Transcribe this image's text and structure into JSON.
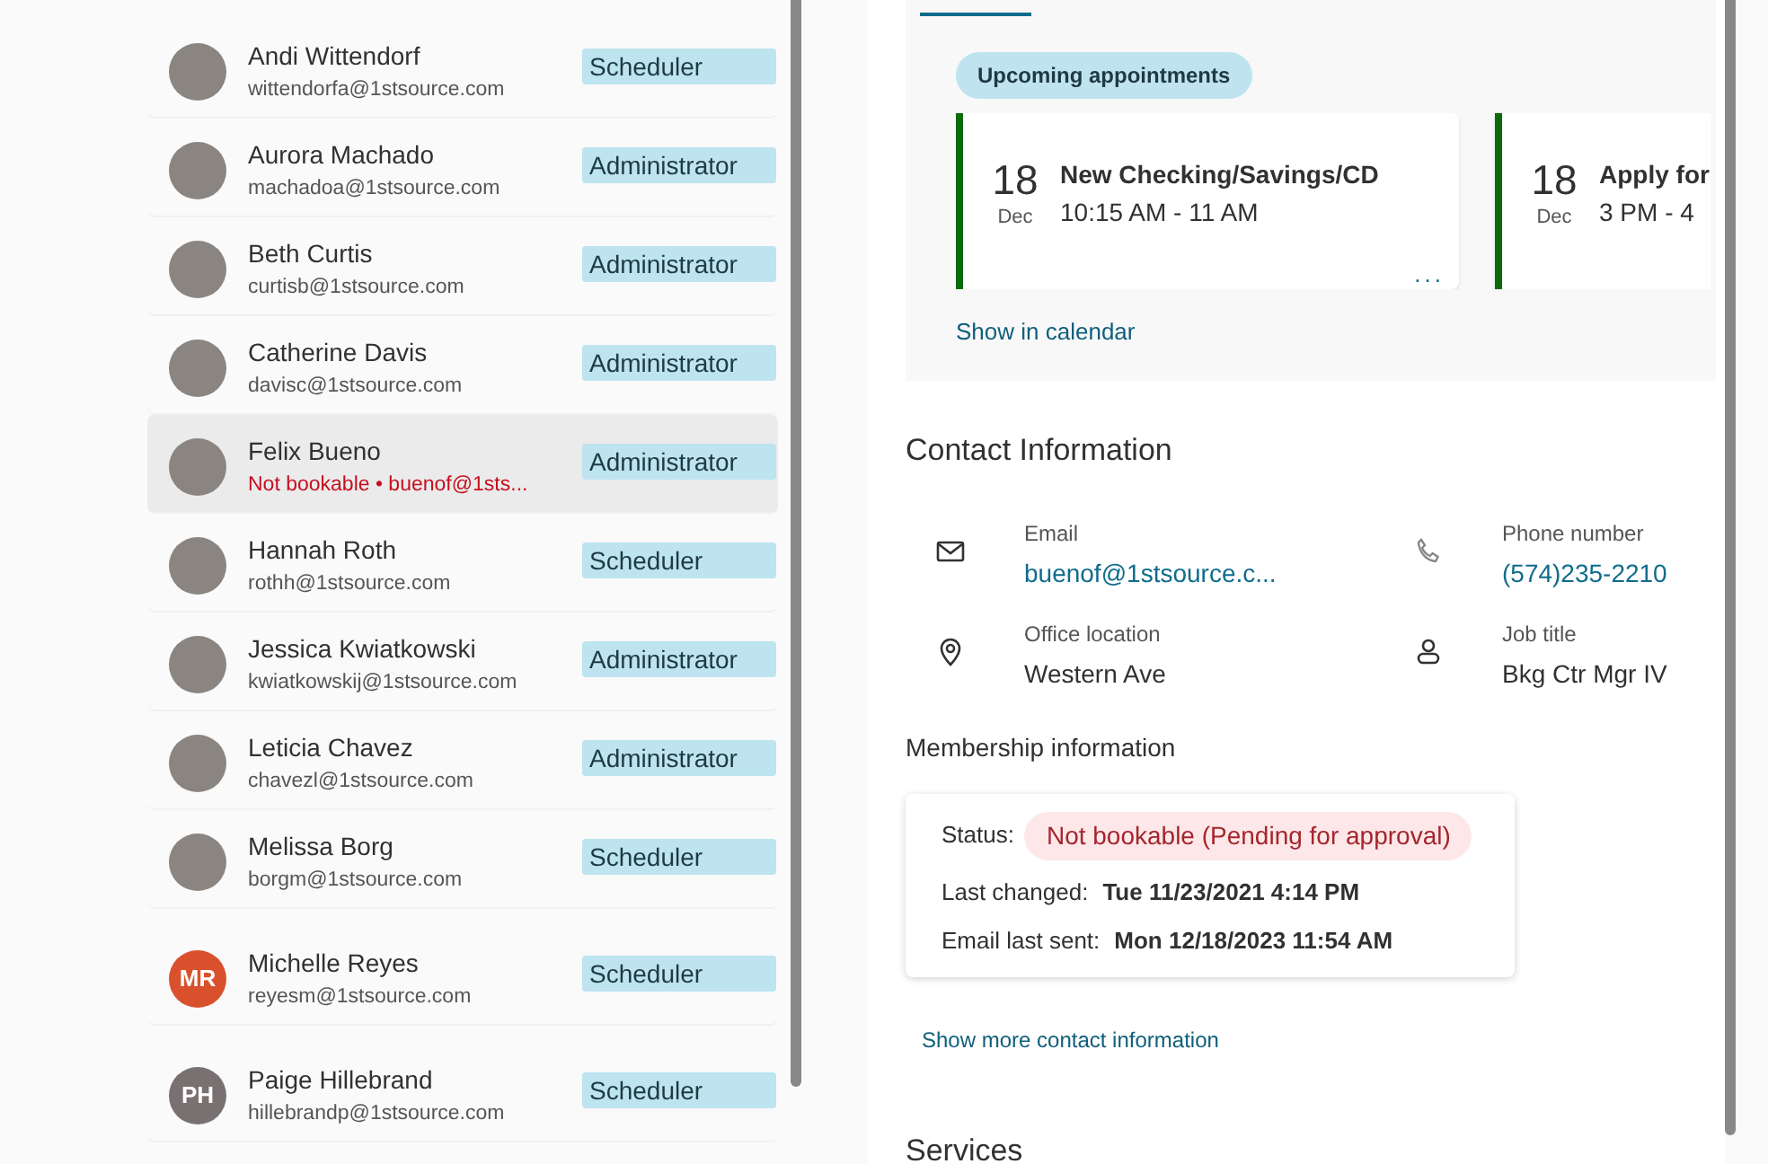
{
  "staff": [
    {
      "name": "Andi Wittendorf",
      "email": "wittendorfa@1stsource.com",
      "role": "Scheduler",
      "selected": false,
      "bookable": true,
      "avatar": {
        "kind": "photo"
      }
    },
    {
      "name": "Aurora Machado",
      "email": "machadoa@1stsource.com",
      "role": "Administrator",
      "selected": false,
      "bookable": true,
      "avatar": {
        "kind": "photo"
      }
    },
    {
      "name": "Beth Curtis",
      "email": "curtisb@1stsource.com",
      "role": "Administrator",
      "selected": false,
      "bookable": true,
      "avatar": {
        "kind": "photo"
      }
    },
    {
      "name": "Catherine Davis",
      "email": "davisc@1stsource.com",
      "role": "Administrator",
      "selected": false,
      "bookable": true,
      "avatar": {
        "kind": "photo"
      }
    },
    {
      "name": "Felix Bueno",
      "email": "Not bookable • buenof@1sts...",
      "role": "Administrator",
      "selected": true,
      "bookable": false,
      "avatar": {
        "kind": "photo"
      }
    },
    {
      "name": "Hannah Roth",
      "email": "rothh@1stsource.com",
      "role": "Scheduler",
      "selected": false,
      "bookable": true,
      "avatar": {
        "kind": "photo"
      }
    },
    {
      "name": "Jessica Kwiatkowski",
      "email": "kwiatkowskij@1stsource.com",
      "role": "Administrator",
      "selected": false,
      "bookable": true,
      "avatar": {
        "kind": "photo"
      }
    },
    {
      "name": "Leticia Chavez",
      "email": "chavezl@1stsource.com",
      "role": "Administrator",
      "selected": false,
      "bookable": true,
      "avatar": {
        "kind": "photo"
      }
    },
    {
      "name": "Melissa Borg",
      "email": "borgm@1stsource.com",
      "role": "Scheduler",
      "selected": false,
      "bookable": true,
      "avatar": {
        "kind": "photo"
      }
    },
    {
      "name": "Michelle Reyes",
      "email": "reyesm@1stsource.com",
      "role": "Scheduler",
      "selected": false,
      "bookable": true,
      "avatar": {
        "kind": "initials",
        "initials": "MR",
        "color": "#d9512c"
      }
    },
    {
      "name": "Paige Hillebrand",
      "email": "hillebrandp@1stsource.com",
      "role": "Scheduler",
      "selected": false,
      "bookable": true,
      "avatar": {
        "kind": "initials",
        "initials": "PH",
        "color": "#797171"
      }
    }
  ],
  "appointments": {
    "badge": "Upcoming appointments",
    "items": [
      {
        "day": "18",
        "month": "Dec",
        "title": "New Checking/Savings/CD",
        "time": "10:15 AM - 11 AM",
        "more": "..."
      },
      {
        "day": "18",
        "month": "Dec",
        "title": "Apply for",
        "time": "3 PM - 4"
      }
    ],
    "link": "Show in calendar"
  },
  "contact": {
    "title": "Contact Information",
    "fields": [
      {
        "kind": "email",
        "label": "Email",
        "value": "buenof@1stsource.c...",
        "link": true
      },
      {
        "kind": "phone",
        "label": "Phone number",
        "value": "(574)235-2210",
        "link": true
      },
      {
        "kind": "location",
        "label": "Office location",
        "value": "Western Ave",
        "link": false
      },
      {
        "kind": "person",
        "label": "Job title",
        "value": "Bkg Ctr Mgr IV",
        "link": false
      }
    ]
  },
  "membership": {
    "title": "Membership information",
    "status_label": "Status:",
    "status": "Not bookable (Pending for approval)",
    "rows": [
      {
        "label": "Last changed:",
        "value": "Tue 11/23/2021 4:14 PM"
      },
      {
        "label": "Email last sent:",
        "value": "Mon 12/18/2023 11:54 AM"
      }
    ]
  },
  "more_link": "Show more contact information",
  "services_title": "Services"
}
